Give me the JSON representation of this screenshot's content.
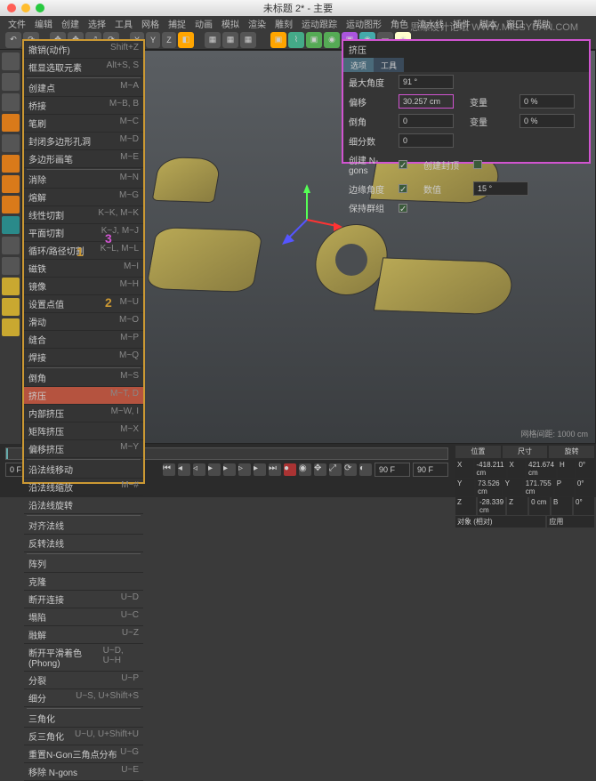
{
  "mac": {
    "title": "未标题 2* - 主要"
  },
  "watermark": "思缘设计论坛 WWW.MISSYUAN.COM",
  "menubar": [
    "文件",
    "编辑",
    "创建",
    "选择",
    "工具",
    "网格",
    "捕捉",
    "动画",
    "模拟",
    "渲染",
    "雕刻",
    "运动跟踪",
    "运动图形",
    "角色",
    "流水线",
    "插件",
    "脚本",
    "窗口",
    "帮助"
  ],
  "axis_btns": [
    "X",
    "Y",
    "Z"
  ],
  "ctx": {
    "items": [
      {
        "l": "撤销(动作)",
        "s": "Shift+Z"
      },
      {
        "l": "框显选取元素",
        "s": "Alt+S, S"
      },
      {
        "sep": true
      },
      {
        "l": "创建点",
        "s": "M~A"
      },
      {
        "l": "桥接",
        "s": "M~B, B"
      },
      {
        "l": "笔刷",
        "s": "M~C"
      },
      {
        "l": "封闭多边形孔洞",
        "s": "M~D"
      },
      {
        "l": "多边形画笔",
        "s": "M~E"
      },
      {
        "sep": true
      },
      {
        "l": "消除",
        "s": "M~N"
      },
      {
        "l": "熔解",
        "s": "M~G"
      },
      {
        "l": "线性切割",
        "s": "K~K, M~K"
      },
      {
        "l": "平面切割",
        "s": "K~J, M~J"
      },
      {
        "l": "循环/路径切割",
        "s": "K~L, M~L"
      },
      {
        "l": "磁铁",
        "s": "M~I"
      },
      {
        "l": "镜像",
        "s": "M~H"
      },
      {
        "l": "设置点值",
        "s": "M~U"
      },
      {
        "l": "滑动",
        "s": "M~O"
      },
      {
        "l": "缝合",
        "s": "M~P"
      },
      {
        "l": "焊接",
        "s": "M~Q"
      },
      {
        "sep": true
      },
      {
        "l": "倒角",
        "s": "M~S",
        "hl": 1
      },
      {
        "l": "挤压",
        "s": "M~T, D",
        "sel": true
      },
      {
        "l": "内部挤压",
        "s": "M~W, I"
      },
      {
        "l": "矩阵挤压",
        "s": "M~X"
      },
      {
        "l": "偏移挤压",
        "s": "M~Y"
      },
      {
        "sep": true
      },
      {
        "l": "沿法线移动",
        "s": ""
      },
      {
        "l": "沿法线缩放",
        "s": "M~#",
        "hl": 2
      },
      {
        "l": "沿法线旋转",
        "s": ""
      },
      {
        "sep": true
      },
      {
        "l": "对齐法线",
        "s": ""
      },
      {
        "l": "反转法线",
        "s": ""
      },
      {
        "sep": true
      },
      {
        "l": "阵列",
        "s": ""
      },
      {
        "l": "克隆",
        "s": ""
      },
      {
        "l": "断开连接",
        "s": "U~D"
      },
      {
        "l": "塌陷",
        "s": "U~C"
      },
      {
        "l": "融解",
        "s": "U~Z"
      },
      {
        "l": "断开平滑着色(Phong)",
        "s": "U~D, U~H"
      },
      {
        "l": "分裂",
        "s": "U~P"
      },
      {
        "l": "细分",
        "s": "U~S, U+Shift+S"
      },
      {
        "sep": true
      },
      {
        "l": "三角化",
        "s": ""
      },
      {
        "l": "反三角化",
        "s": "U~U, U+Shift+U"
      },
      {
        "l": "重置N-Gon三角点分布",
        "s": "U~G"
      },
      {
        "l": "移除 N-gons",
        "s": "U~E"
      }
    ]
  },
  "annotations": {
    "n1": "1",
    "n2": "2",
    "n3": "3"
  },
  "attr": {
    "header": "挤压",
    "tab1": "选项",
    "tab2": "工具",
    "rows": [
      {
        "l": "最大角度",
        "v": "91 °"
      },
      {
        "l": "偏移",
        "v": "30.257 cm",
        "hot": true,
        "l2": "变量",
        "v2": "0 %"
      },
      {
        "l": "倒角",
        "v": "0",
        "l2": "变量",
        "v2": "0 %"
      },
      {
        "l": "细分数",
        "v": "0"
      },
      {
        "l": "创建 N-gons",
        "chk": true,
        "l2": "创建封顶",
        "chk2": false
      },
      {
        "l": "边缘角度",
        "chk": true,
        "l2": "数值",
        "v2": "15 °"
      },
      {
        "l": "保持群组",
        "chk": true
      }
    ]
  },
  "viewport": {
    "grid_label": "网格间距: 1000 cm"
  },
  "timeline": {
    "start": "0 F",
    "cur": "0",
    "end": "90 F",
    "end2": "90 F"
  },
  "coords": {
    "tabs": [
      "位置",
      "尺寸",
      "旋转"
    ],
    "rows": [
      [
        "X",
        "-418.211 cm",
        "X",
        "421.674 cm",
        "H",
        "0°"
      ],
      [
        "Y",
        "73.526 cm",
        "Y",
        "171.755 cm",
        "P",
        "0°"
      ],
      [
        "Z",
        "-28.339 cm",
        "Z",
        "0 cm",
        "B",
        "0°"
      ]
    ],
    "obj": "对象 (相对)",
    "apply": "应用"
  }
}
